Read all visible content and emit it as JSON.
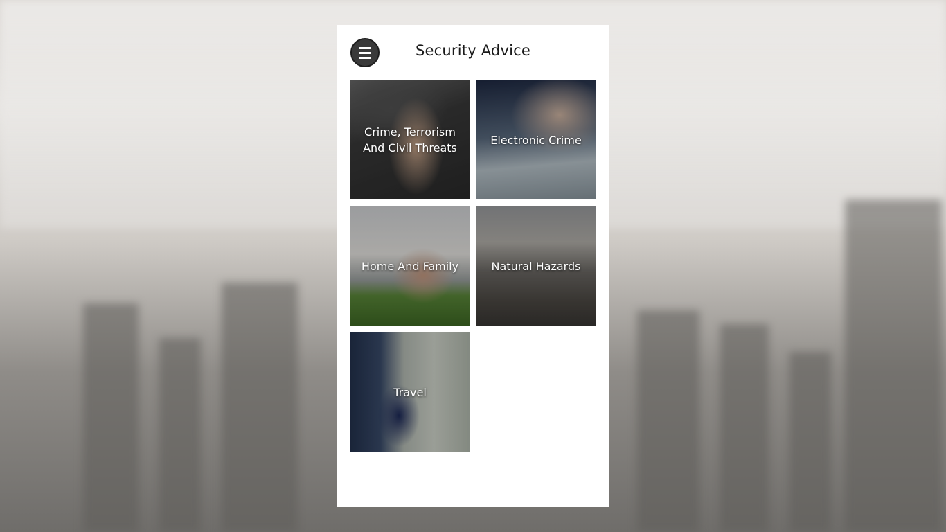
{
  "header": {
    "title": "Security Advice",
    "menu_icon": "hamburger-menu-icon"
  },
  "categories": [
    {
      "label": "Crime, Terrorism And Civil Threats"
    },
    {
      "label": "Electronic Crime"
    },
    {
      "label": "Home And Family"
    },
    {
      "label": "Natural Hazards"
    },
    {
      "label": "Travel"
    }
  ],
  "colors": {
    "menu_button_bg": "#3a3a3a",
    "title_text": "#1a1a1a",
    "tile_text": "#ffffff",
    "panel_bg": "#ffffff"
  }
}
